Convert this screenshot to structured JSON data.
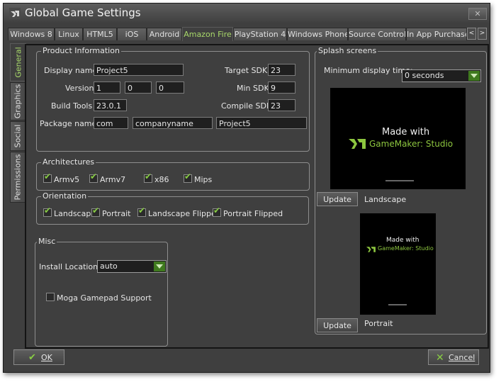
{
  "window": {
    "title": "Global Game Settings",
    "close_glyph": "✕"
  },
  "tabs": [
    "Windows 8",
    "Linux",
    "HTML5",
    "iOS",
    "Android",
    "Amazon Fire",
    "PlayStation 4",
    "Windows Phone",
    "Source Control",
    "In App Purchase"
  ],
  "active_tab": "Amazon Fire",
  "tab_scroll": {
    "left": "<",
    "right": ">"
  },
  "side_tabs": [
    "General",
    "Graphics",
    "Social",
    "Permissions"
  ],
  "active_side_tab": "General",
  "product": {
    "legend": "Product Information",
    "display_name_label": "Display name",
    "display_name": "Project5",
    "version_label": "Version",
    "version": [
      "1",
      "0",
      "0"
    ],
    "build_tools_label": "Build Tools",
    "build_tools": "23.0.1",
    "package_name_label": "Package name",
    "package": [
      "com",
      "companyname",
      "Project5"
    ],
    "target_sdk_label": "Target SDK",
    "target_sdk": "23",
    "min_sdk_label": "Min SDK",
    "min_sdk": "9",
    "compile_sdk_label": "Compile SDK",
    "compile_sdk": "23"
  },
  "architectures": {
    "legend": "Architectures",
    "items": [
      "Armv5",
      "Armv7",
      "x86",
      "Mips"
    ]
  },
  "orientation": {
    "legend": "Orientation",
    "items": [
      "Landscape",
      "Portrait",
      "Landscape Flipped",
      "Portrait Flipped"
    ]
  },
  "misc": {
    "legend": "Misc",
    "install_location_label": "Install Location:",
    "install_location": "auto",
    "moga_label": "Moga Gamepad Support",
    "moga_checked": false
  },
  "splash": {
    "legend": "Splash screens",
    "min_display_label": "Minimum display time:",
    "min_display": "0 seconds",
    "made_with": "Made with",
    "brand": "GameMaker: Studio",
    "landscape_label": "Landscape",
    "portrait_label": "Portrait",
    "update_label": "Update"
  },
  "buttons": {
    "ok": "OK",
    "cancel": "Cancel"
  },
  "colors": {
    "accent_green": "#88cc44",
    "brand_green": "#8dc63f",
    "panel": "#3f3f3f"
  }
}
